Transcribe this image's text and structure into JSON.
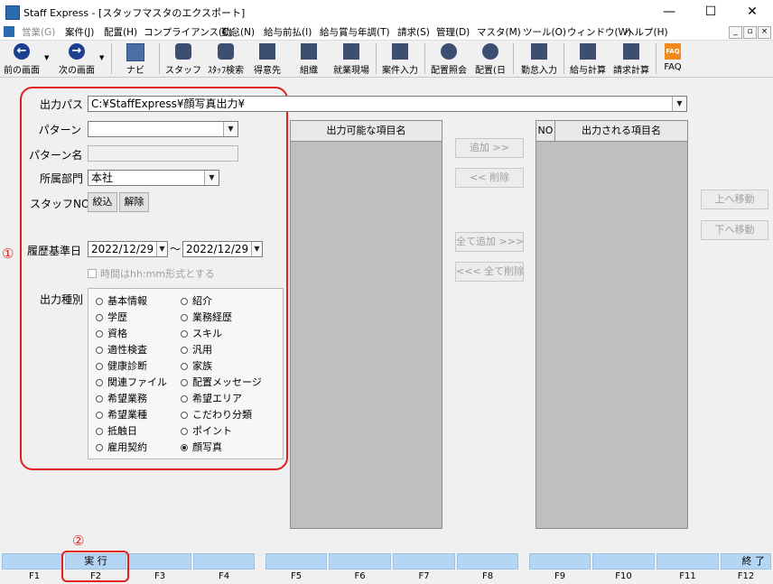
{
  "window": {
    "title": "Staff Express - [スタッフマスタのエクスポート]",
    "controls": {
      "minimize": "—",
      "maximize": "☐",
      "close": "✕"
    }
  },
  "menu": {
    "items": [
      "営業(G)",
      "案件(J)",
      "配置(H)",
      "コンプライアンス(C)",
      "勤怠(N)",
      "給与前払(I)",
      "給与賞与年調(T)",
      "請求(S)",
      "管理(D)",
      "マスタ(M)",
      "ツール(O)",
      "ウィンドウ(W)",
      "ヘルプ(H)"
    ],
    "mdi_controls": [
      "_",
      "▫",
      "×"
    ]
  },
  "toolbar": {
    "prev_label": "前の画面",
    "next_label": "次の画面",
    "navi_label": "ナビ",
    "staff_label": "スタッフ",
    "staff_search_label": "ｽﾀｯﾌ検索",
    "client_label": "得意先",
    "org_label": "組織",
    "site_label": "就業現場",
    "case_input_label": "案件入力",
    "placement_query_label": "配置照会",
    "placement_day_label": "配置(日",
    "attendance_label": "勤怠入力",
    "payroll_label": "給与計算",
    "billing_label": "請求計算",
    "faq_label": "FAQ",
    "faq_icon_text": "FAQ"
  },
  "form": {
    "output_path_label": "出力パス",
    "output_path_value": "C:¥StaffExpress¥顔写真出力¥",
    "pattern_label": "パターン",
    "pattern_value": "",
    "pattern_name_label": "パターン名",
    "pattern_name_value": "",
    "department_label": "所属部門",
    "department_value": "本社",
    "staff_no_label": "スタッフNO",
    "narrow_button": "絞込",
    "release_button": "解除",
    "history_date_label": "履歴基準日",
    "date_from": "2022/12/29",
    "date_tilde": "～",
    "date_to": "2022/12/29",
    "time_format_label": "時間はhh:mm形式とする",
    "output_type_label": "出力種別",
    "output_types_left": [
      "基本情報",
      "学歴",
      "資格",
      "適性検査",
      "健康診断",
      "関連ファイル",
      "希望業務",
      "希望業種",
      "抵触日",
      "雇用契約"
    ],
    "output_types_right": [
      "紹介",
      "業務経歴",
      "スキル",
      "汎用",
      "家族",
      "配置メッセージ",
      "希望エリア",
      "こだわり分類",
      "ポイント",
      "顔写真"
    ],
    "selected_output_type": "顔写真"
  },
  "lists": {
    "available_header": "出力可能な項目名",
    "output_no_header": "NO",
    "output_header": "出力される項目名",
    "add_button": "追加 >>",
    "delete_button": "<< 削除",
    "add_all_button": "全て追加 >>>",
    "delete_all_button": "<<< 全て削除",
    "move_up_button": "上へ移動",
    "move_down_button": "下へ移動"
  },
  "annotations": {
    "circle1": "①",
    "circle2": "②"
  },
  "fkeys": {
    "labels": [
      "",
      "実 行",
      "",
      "",
      "",
      "",
      "",
      "",
      "",
      "",
      "",
      "終 了"
    ],
    "names": [
      "F1",
      "F2",
      "F3",
      "F4",
      "F5",
      "F6",
      "F7",
      "F8",
      "F9",
      "F10",
      "F11",
      "F12"
    ]
  }
}
